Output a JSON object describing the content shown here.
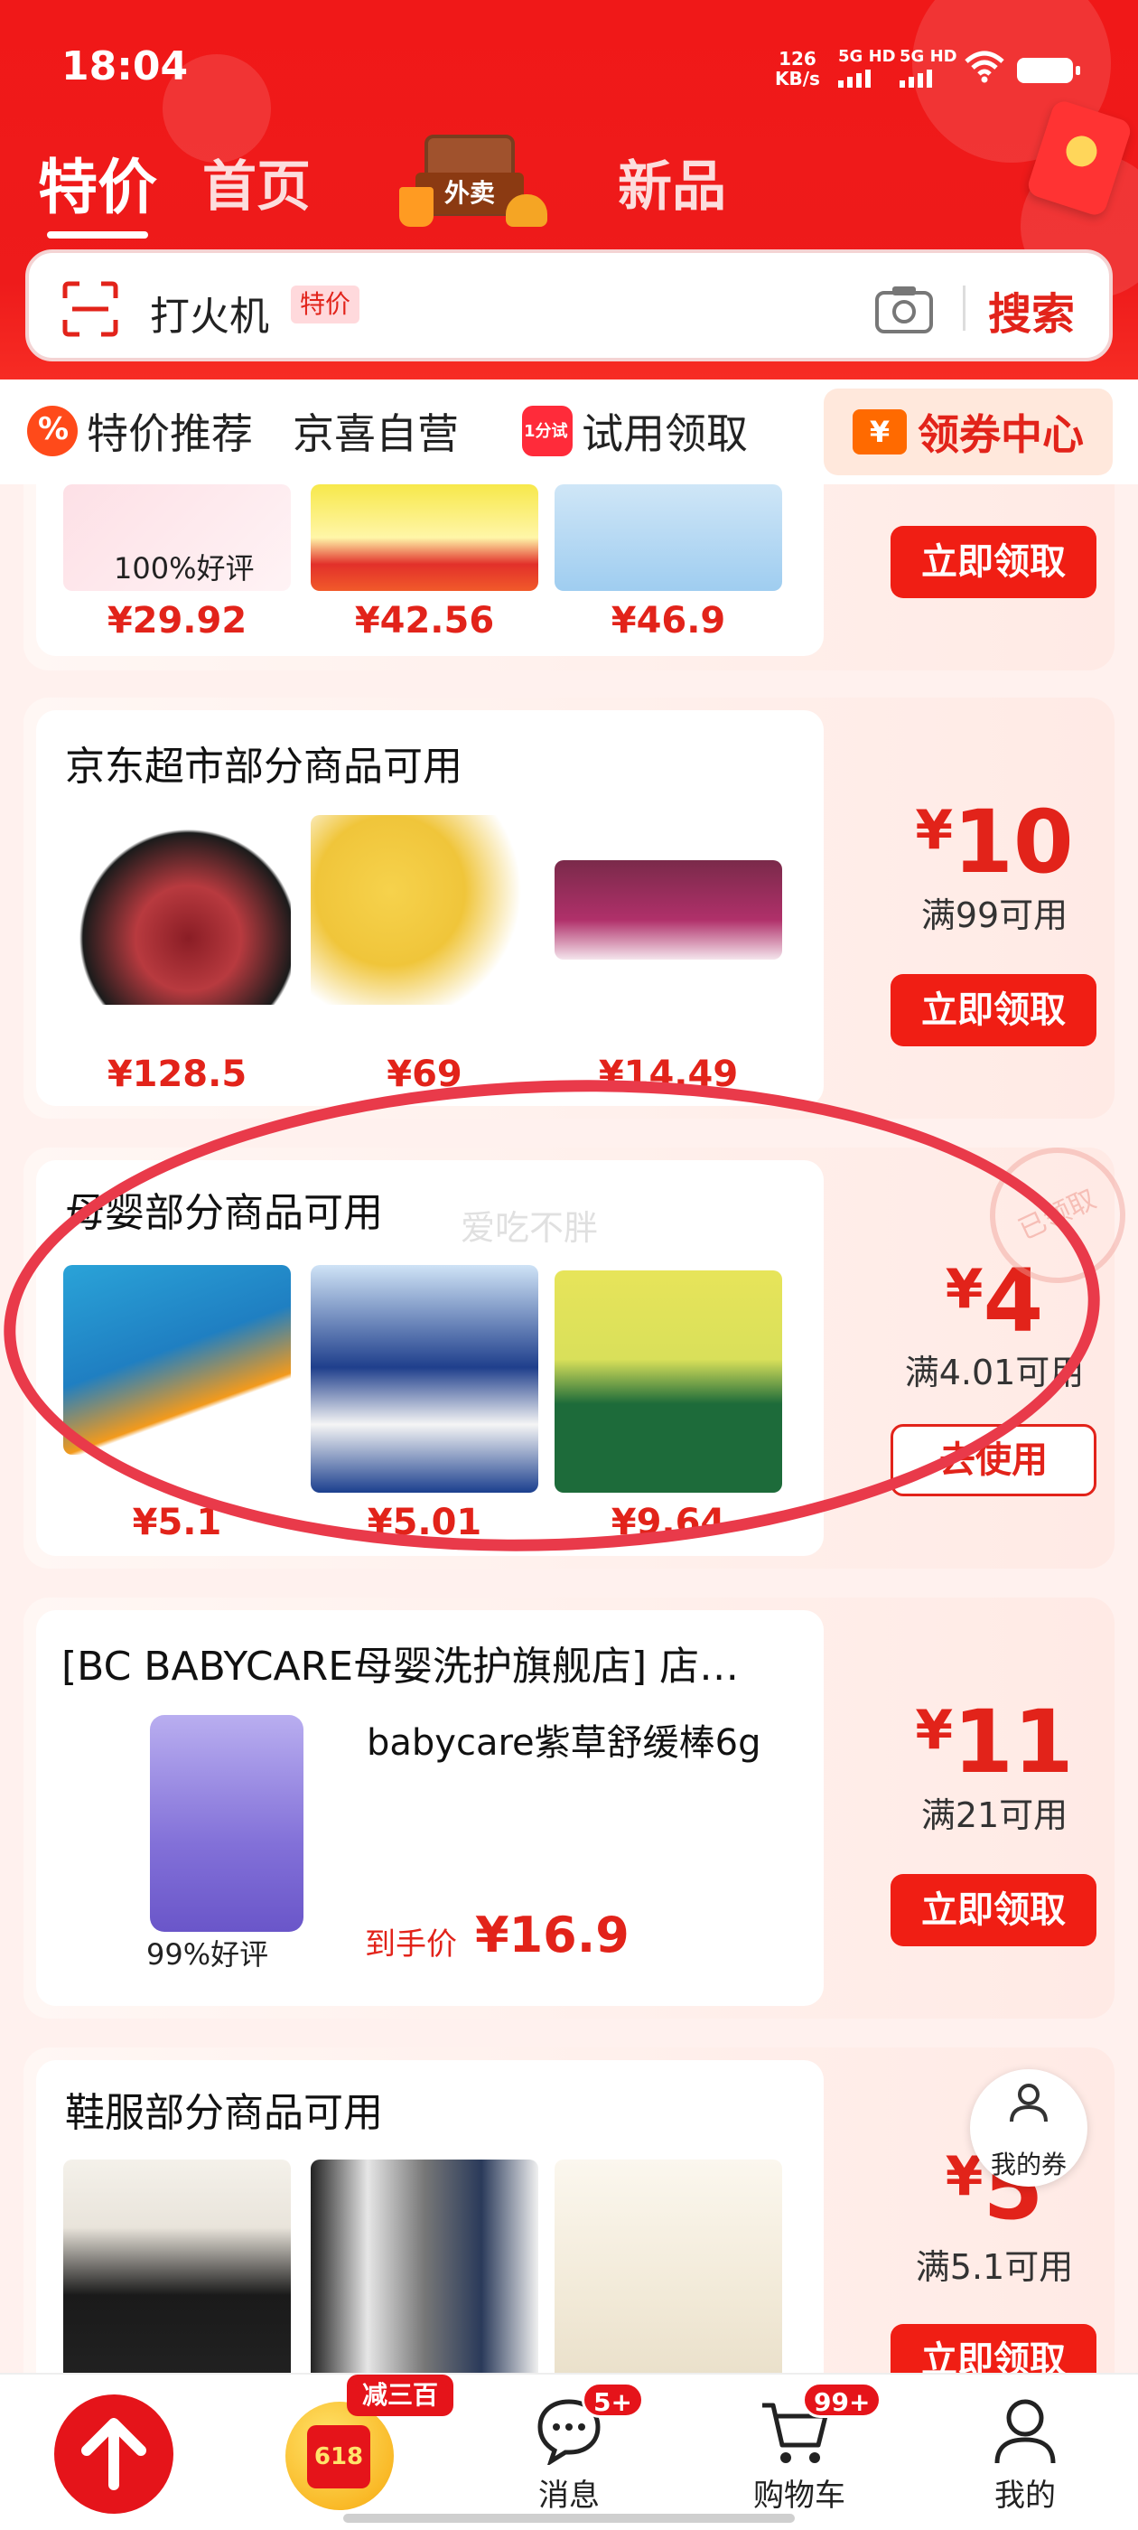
{
  "status": {
    "time": "18:04",
    "net_speed": "126",
    "net_unit": "KB/s",
    "sig1": "5G HD",
    "sig2": "5G HD"
  },
  "nav": {
    "tabs": [
      "特价",
      "首页",
      "新品"
    ],
    "waimai": "外卖"
  },
  "search": {
    "query": "打火机",
    "tag": "特价",
    "button": "搜索"
  },
  "categories": [
    "特价推荐",
    "京喜自营",
    "试用领取"
  ],
  "categories_extra": {
    "coupon_center": "领券中心",
    "trial_icon": "1分试"
  },
  "cards": [
    {
      "prices": [
        "¥29.92",
        "¥42.56",
        "¥46.9"
      ],
      "good_rate": "100%好评",
      "button": "立即领取"
    },
    {
      "title": "京东超市部分商品可用",
      "prices": [
        "¥128.5",
        "¥69",
        "¥14.49"
      ],
      "amount_yen": "¥",
      "amount": "10",
      "condition": "满99可用",
      "button": "立即领取"
    },
    {
      "title": "母婴部分商品可用",
      "prices": [
        "¥5.1",
        "¥5.01",
        "¥9.64"
      ],
      "amount_yen": "¥",
      "amount": "4",
      "condition": "满4.01可用",
      "button": "去使用",
      "stamp": "已领取",
      "watermark": "爱吃不胖"
    },
    {
      "title": "[BC BABYCARE母婴洗护旗舰店] 店…",
      "product_name": "babycare紫草舒缓棒6g",
      "good_rate": "99%好评",
      "final_price_label": "到手价",
      "final_price": "¥16.9",
      "amount_yen": "¥",
      "amount": "11",
      "condition": "满21可用",
      "button": "立即领取"
    },
    {
      "title": "鞋服部分商品可用",
      "amount_yen": "¥",
      "amount": "5",
      "condition": "满5.1可用",
      "button": "立即领取"
    }
  ],
  "my_coupon": "我的券",
  "bottom_nav": {
    "promo_tag": "减三百",
    "promo_618": "618",
    "messages": "消息",
    "messages_badge": "5+",
    "cart": "购物车",
    "cart_badge": "99+",
    "mine": "我的"
  },
  "colors": {
    "brand_red": "#e2231a",
    "header_red": "#f01818",
    "annotation": "#e93a4a"
  }
}
